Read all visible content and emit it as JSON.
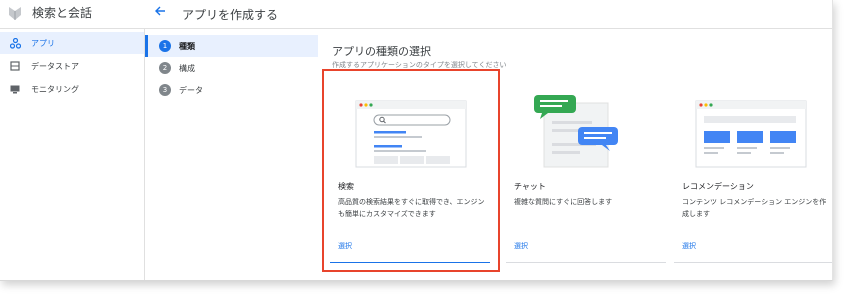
{
  "header": {
    "product_name": "検索と会話",
    "back_icon": "arrow-left-icon",
    "page_title": "アプリを作成する"
  },
  "sidebar": {
    "items": [
      {
        "label": "アプリ",
        "icon": "apps-icon",
        "active": true
      },
      {
        "label": "データストア",
        "icon": "datastore-icon",
        "active": false
      },
      {
        "label": "モニタリング",
        "icon": "monitoring-icon",
        "active": false
      }
    ]
  },
  "stepper": {
    "steps": [
      {
        "number": "1",
        "label": "種類",
        "active": true
      },
      {
        "number": "2",
        "label": "構成",
        "active": false
      },
      {
        "number": "3",
        "label": "データ",
        "active": false
      }
    ]
  },
  "main": {
    "title": "アプリの種類の選択",
    "subtitle": "作成するアプリケーションのタイプを選択してください",
    "cards": [
      {
        "title": "検索",
        "description": "高品質の検索結果をすぐに取得でき、エンジンも簡単にカスタマイズできます",
        "select_label": "選択",
        "selected": true
      },
      {
        "title": "チャット",
        "description": "複雑な質問にすぐに回答します",
        "select_label": "選択",
        "selected": false
      },
      {
        "title": "レコメンデーション",
        "description": "コンテンツ レコメンデーション エンジンを作成します",
        "select_label": "選択",
        "selected": false
      }
    ]
  },
  "colors": {
    "accent": "#1a73e8",
    "active_bg": "#e8f0fe",
    "highlight": "#e8442c",
    "chat_green": "#34a853"
  }
}
